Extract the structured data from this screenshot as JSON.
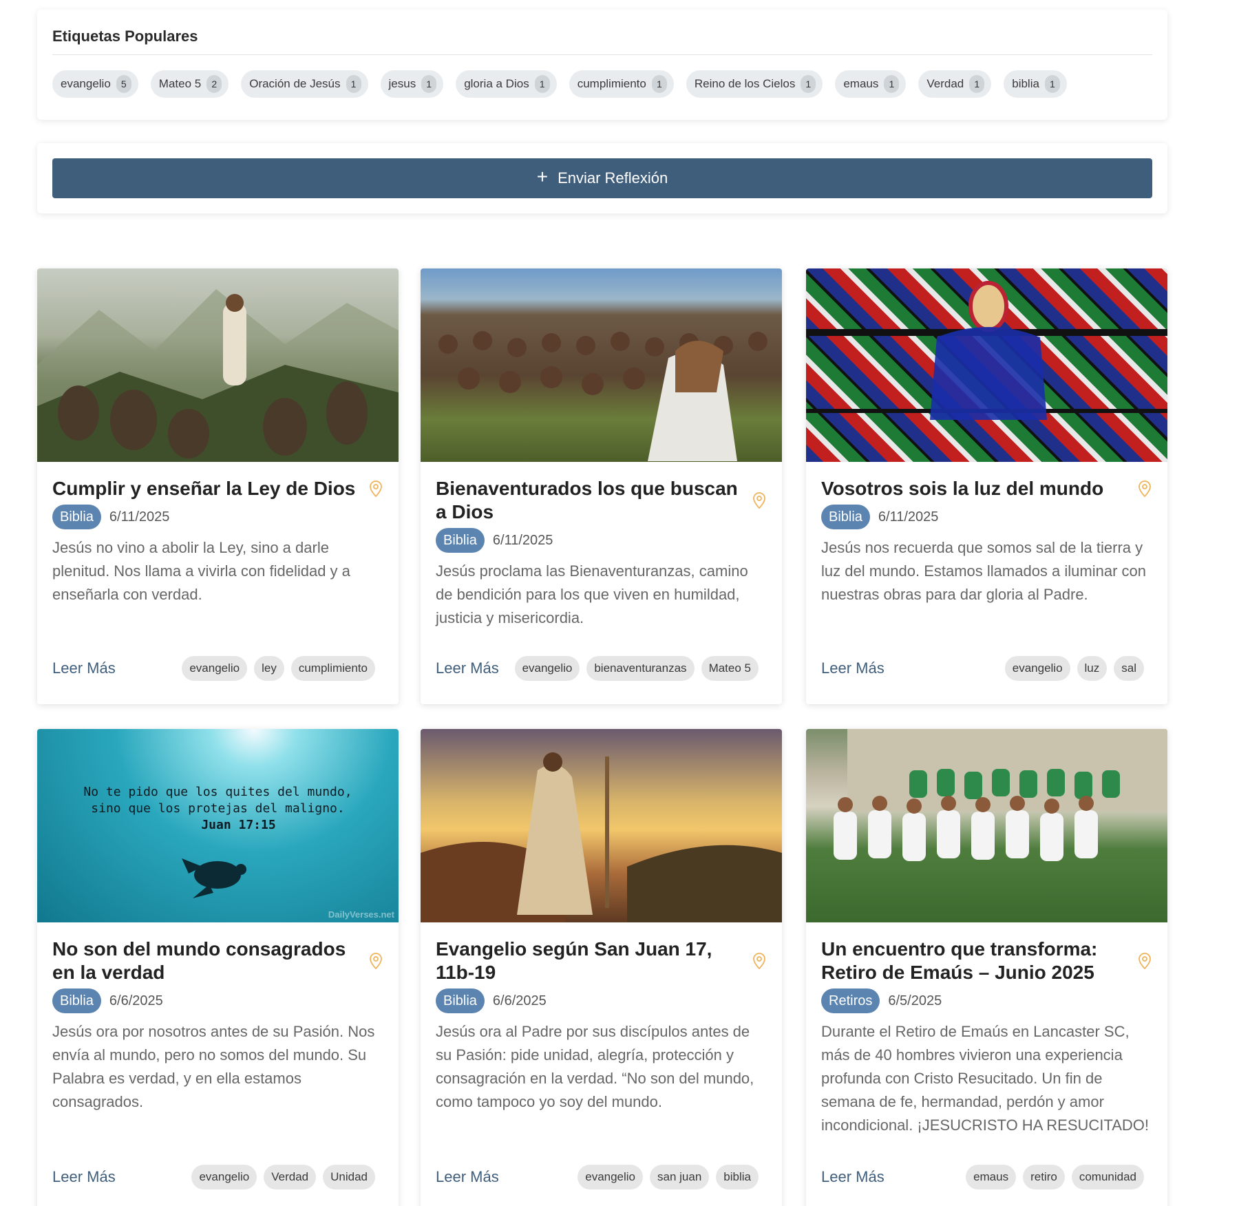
{
  "popular_tags": {
    "title": "Etiquetas Populares",
    "items": [
      {
        "label": "evangelio",
        "count": "5"
      },
      {
        "label": "Mateo 5",
        "count": "2"
      },
      {
        "label": "Oración de Jesús",
        "count": "1"
      },
      {
        "label": "jesus",
        "count": "1"
      },
      {
        "label": "gloria a Dios",
        "count": "1"
      },
      {
        "label": "cumplimiento",
        "count": "1"
      },
      {
        "label": "Reino de los Cielos",
        "count": "1"
      },
      {
        "label": "emaus",
        "count": "1"
      },
      {
        "label": "Verdad",
        "count": "1"
      },
      {
        "label": "biblia",
        "count": "1"
      }
    ]
  },
  "submit": {
    "label": "Enviar Reflexión",
    "icon": "plus-icon"
  },
  "colors": {
    "primary": "#3f5e7c",
    "category": "#5b84b1",
    "pin": "#f0b35a"
  },
  "read_more_label": "Leer Más",
  "posts": [
    {
      "title": "Cumplir y enseñar la Ley de Dios",
      "category": "Biblia",
      "date": "6/11/2025",
      "excerpt": "Jesús no vino a abolir la Ley, sino a darle plenitud. Nos llama a vivirla con fidelidad y a enseñarla con verdad.",
      "tags": [
        "evangelio",
        "ley",
        "cumplimiento"
      ],
      "image": "jesus-teaching-on-mountain"
    },
    {
      "title": "Bienaventurados los que buscan a Dios",
      "category": "Biblia",
      "date": "6/11/2025",
      "excerpt": "Jesús proclama las Bienaventuranzas, camino de bendición para los que viven en humildad, justicia y misericordia.",
      "tags": [
        "evangelio",
        "bienaventuranzas",
        "Mateo 5"
      ],
      "image": "sermon-on-the-mount-crowd"
    },
    {
      "title": "Vosotros sois la luz del mundo",
      "category": "Biblia",
      "date": "6/11/2025",
      "excerpt": "Jesús nos recuerda que somos sal de la tierra y luz del mundo. Estamos llamados a iluminar con nuestras obras para dar gloria al Padre.",
      "tags": [
        "evangelio",
        "luz",
        "sal"
      ],
      "image": "stained-glass-christ"
    },
    {
      "title": "No son del mundo consagrados en la verdad",
      "category": "Biblia",
      "date": "6/6/2025",
      "excerpt": "Jesús ora por nosotros antes de su Pasión. Nos envía al mundo, pero no somos del mundo. Su Palabra es verdad, y en ella estamos consagrados.",
      "tags": [
        "evangelio",
        "Verdad",
        "Unidad"
      ],
      "image": "underwater-turtle-verse",
      "image_text": [
        "No te pido que los quites del mundo,",
        "sino que los protejas del maligno.",
        "Juan 17:15"
      ],
      "image_watermark": "DailyVerses.net"
    },
    {
      "title": "Evangelio según San Juan 17, 11b-19",
      "category": "Biblia",
      "date": "6/6/2025",
      "excerpt": "Jesús ora al Padre por sus discípulos antes de su Pasión: pide unidad, alegría, protección y consagración en la verdad. “No son del mundo, como tampoco yo soy del mundo.",
      "tags": [
        "evangelio",
        "san juan",
        "biblia"
      ],
      "image": "jesus-overlooking-valley"
    },
    {
      "title": "Un encuentro que transforma: Retiro de Emaús – Junio 2025",
      "category": "Retiros",
      "date": "6/5/2025",
      "excerpt": "Durante el Retiro de Emaús en Lancaster SC, más de 40 hombres vivieron una experiencia profunda con Cristo Resucitado. Un fin de semana de fe, hermandad, perdón y amor incondicional. ¡JESUCRISTO HA RESUCITADO!",
      "tags": [
        "emaus",
        "retiro",
        "comunidad"
      ],
      "image": "retreat-group-photo"
    }
  ]
}
